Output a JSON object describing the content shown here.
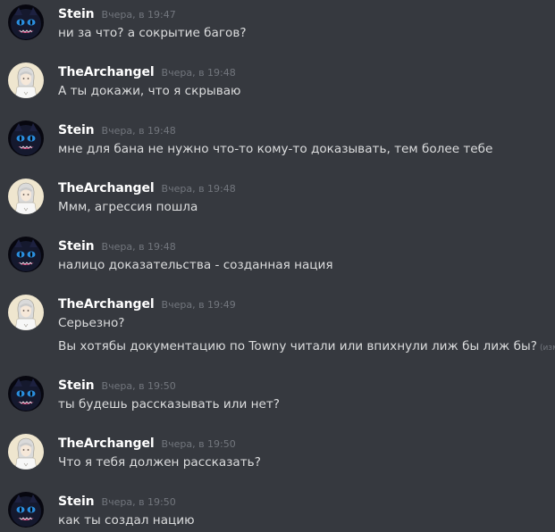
{
  "messages": [
    {
      "author": "Stein",
      "timestamp": "Вчера, в 19:47",
      "lines": [
        "ни за что? а сокрытие багов?"
      ]
    },
    {
      "author": "TheArchangel",
      "timestamp": "Вчера, в 19:48",
      "lines": [
        "А ты докажи, что я скрываю"
      ]
    },
    {
      "author": "Stein",
      "timestamp": "Вчера, в 19:48",
      "lines": [
        "мне для бана не нужно что-то кому-то доказывать, тем более тебе"
      ]
    },
    {
      "author": "TheArchangel",
      "timestamp": "Вчера, в 19:48",
      "lines": [
        "Ммм, агрессия пошла"
      ]
    },
    {
      "author": "Stein",
      "timestamp": "Вчера, в 19:48",
      "lines": [
        "налицо доказательства - созданная нация"
      ]
    },
    {
      "author": "TheArchangel",
      "timestamp": "Вчера, в 19:49",
      "lines": [
        "Серьезно?",
        "Вы хотябы документацию по Towny читали или впихнули лиж бы лиж бы?"
      ],
      "edited_label": "(измене"
    },
    {
      "author": "Stein",
      "timestamp": "Вчера, в 19:50",
      "lines": [
        "ты будешь рассказывать или нет?"
      ]
    },
    {
      "author": "TheArchangel",
      "timestamp": "Вчера, в 19:50",
      "lines": [
        "Что я тебя должен рассказать?"
      ]
    },
    {
      "author": "Stein",
      "timestamp": "Вчера, в 19:50",
      "lines": [
        "как ты создал нацию"
      ]
    }
  ]
}
